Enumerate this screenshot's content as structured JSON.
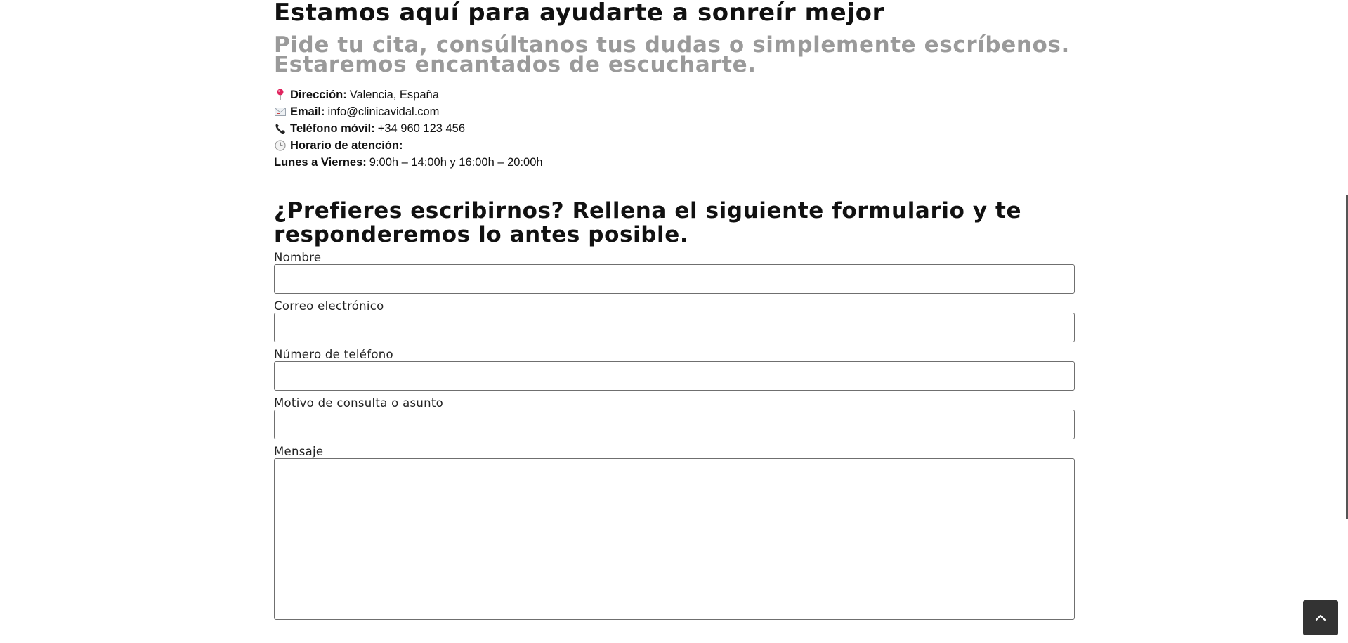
{
  "header": {
    "title": "Estamos aquí para ayudarte a sonreír mejor",
    "subtitle": "Pide tu cita, consúltanos tus dudas o simplemente escríbenos. Estaremos encantados de escucharte."
  },
  "contact_info": {
    "address_label": "Dirección:",
    "address_value": "Valencia, España",
    "email_label": "Email:",
    "email_value": "info@clinicavidal.com",
    "phone_label": "Teléfono móvil:",
    "phone_value": "+34 960 123 456",
    "hours_label": "Horario de atención:",
    "days_label": "Lunes a Viernes:",
    "days_value": "9:00h – 14:00h y 16:00h – 20:00h",
    "icons": [
      "pin-icon",
      "envelope-icon",
      "phone-icon",
      "clock-icon"
    ]
  },
  "form": {
    "title": "¿Prefieres escribirnos? Rellena el siguiente formulario y te responderemos lo antes posible.",
    "fields": [
      {
        "label": "Nombre",
        "value": ""
      },
      {
        "label": "Correo electrónico",
        "value": ""
      },
      {
        "label": "Número de teléfono",
        "value": ""
      },
      {
        "label": "Motivo de consulta o asunto",
        "value": ""
      },
      {
        "label": "Mensaje",
        "value": ""
      }
    ]
  },
  "colors": {
    "heading": "#111111",
    "subtitle": "#9a9a9a",
    "input_border": "#6f6f6f",
    "scroll_button": "#333333"
  },
  "scroll_top": {
    "icon": "chevron-up-icon"
  }
}
